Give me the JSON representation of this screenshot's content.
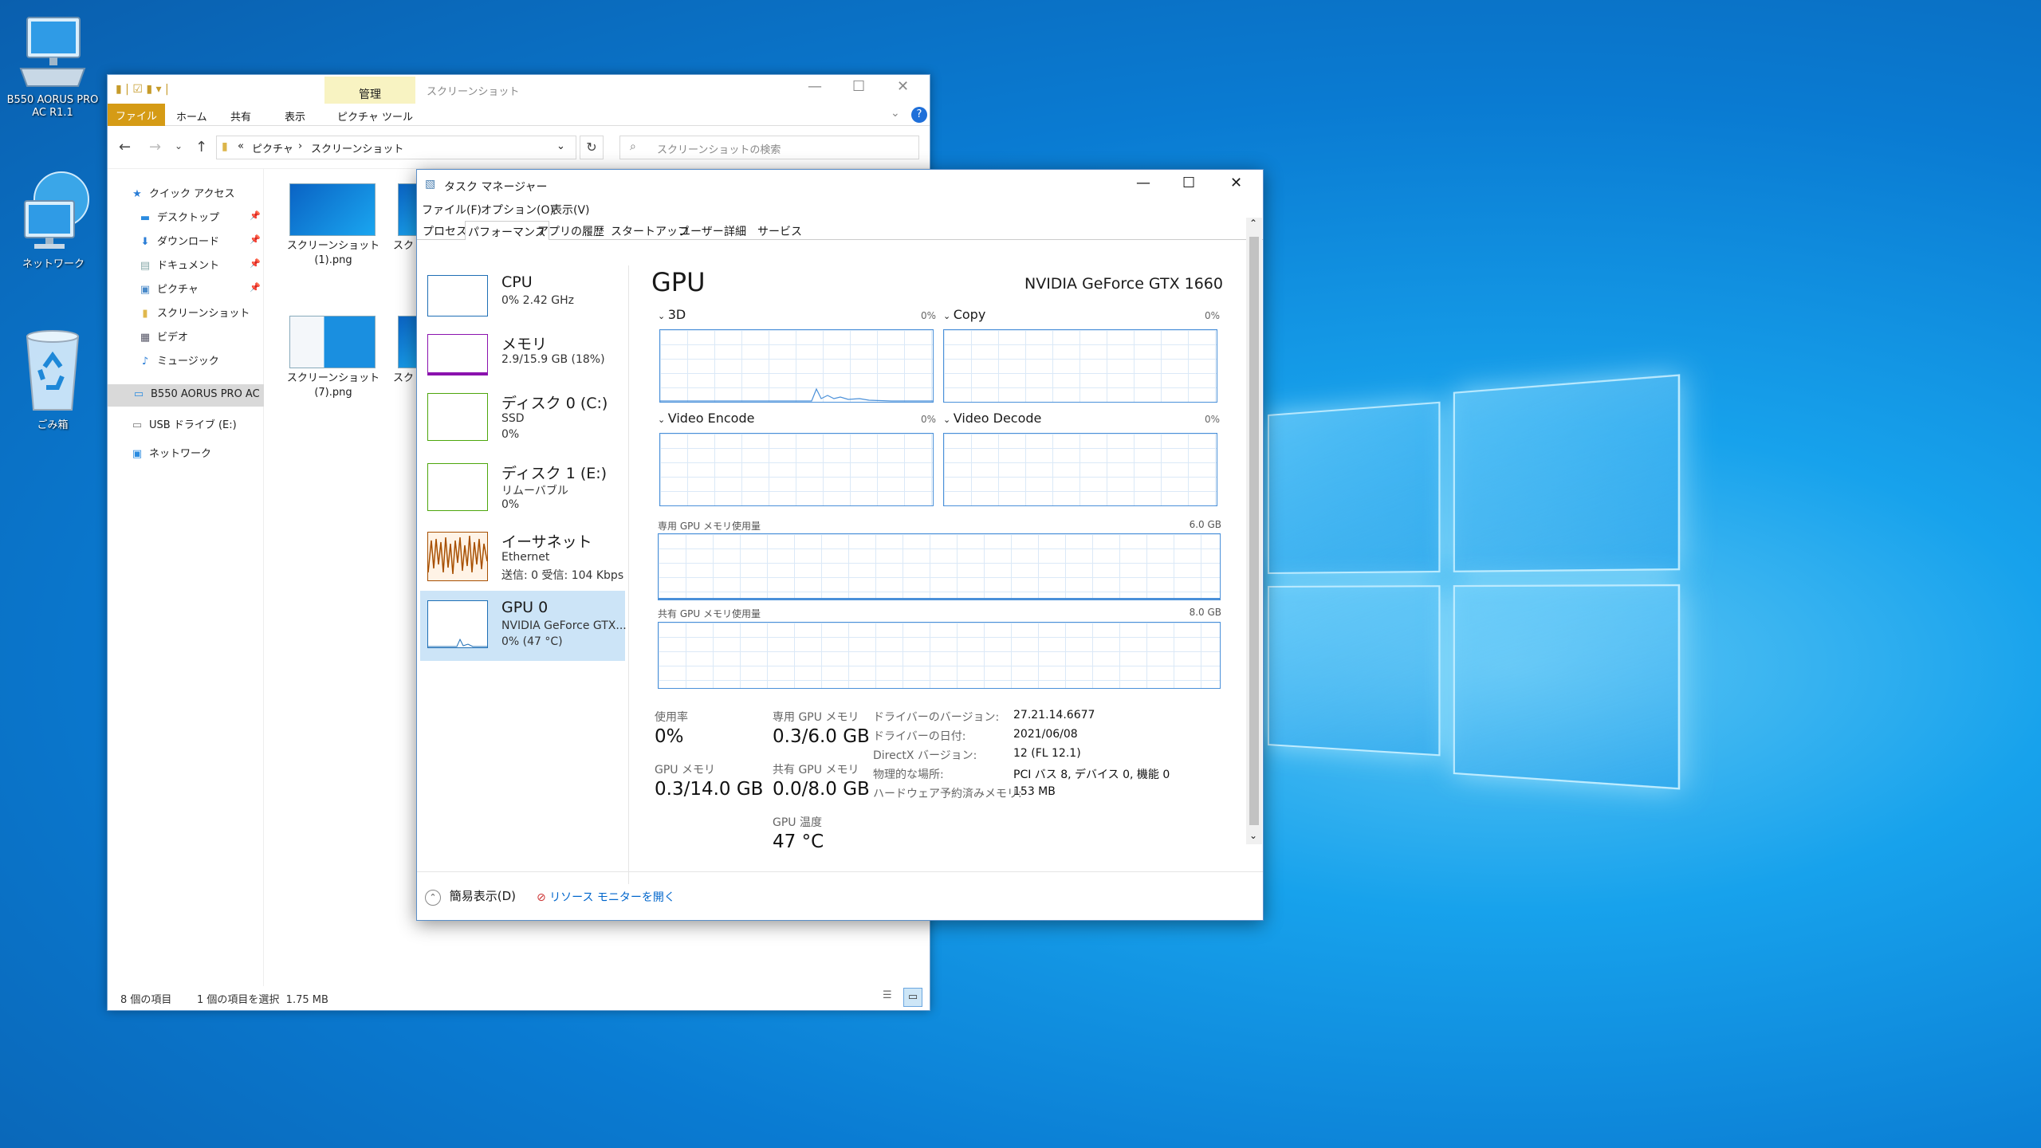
{
  "desktop": {
    "icons": [
      {
        "label": "B550 AORUS PRO\nAC R1.1",
        "icon": "computer-icon"
      },
      {
        "label": "ネットワーク",
        "icon": "network-icon"
      },
      {
        "label": "ごみ箱",
        "icon": "recycle-bin-icon"
      }
    ],
    "colors": {
      "background": "#0a7bd2",
      "logo": "#7fd3ff"
    }
  },
  "explorer": {
    "ribbon_context_group": "管理",
    "window_title": "スクリーンショット",
    "tabs": [
      "ファイル",
      "ホーム",
      "共有",
      "表示",
      "ピクチャ ツール"
    ],
    "address": {
      "prefix": "«",
      "parent": "ピクチャ",
      "current": "スクリーンショット"
    },
    "search_placeholder": "スクリーンショットの検索",
    "nav": [
      {
        "label": "クイック アクセス",
        "icon": "star-icon"
      },
      {
        "label": "デスクトップ",
        "icon": "desktop-icon",
        "pinned": true
      },
      {
        "label": "ダウンロード",
        "icon": "download-icon",
        "pinned": true
      },
      {
        "label": "ドキュメント",
        "icon": "document-icon",
        "pinned": true
      },
      {
        "label": "ピクチャ",
        "icon": "pictures-icon",
        "pinned": true
      },
      {
        "label": "スクリーンショット",
        "icon": "folder-icon"
      },
      {
        "label": "ビデオ",
        "icon": "video-icon"
      },
      {
        "label": "ミュージック",
        "icon": "music-icon"
      },
      {
        "label": "B550 AORUS PRO AC",
        "icon": "computer-icon"
      },
      {
        "label": "USB ドライブ (E:)",
        "icon": "usb-drive-icon"
      },
      {
        "label": "ネットワーク",
        "icon": "network-icon"
      }
    ],
    "files": [
      {
        "name": "スクリーンショット\n(1).png"
      },
      {
        "name": "スク"
      },
      {
        "name": "スクリーンショット\n(7).png"
      },
      {
        "name": "スク"
      }
    ],
    "status": {
      "count": "8 個の項目",
      "selection": "1 個の項目を選択  1.75 MB"
    }
  },
  "taskmanager": {
    "title": "タスク マネージャー",
    "menu": [
      "ファイル(F)",
      "オプション(O)",
      "表示(V)"
    ],
    "tabs": [
      "プロセス",
      "パフォーマンス",
      "アプリの履歴",
      "スタートアップ",
      "ユーザー",
      "詳細",
      "サービス"
    ],
    "selected_tab": "パフォーマンス",
    "sidebar": [
      {
        "name": "CPU",
        "l1": "0% 2.42 GHz",
        "l2": "",
        "color": "#1f6fb5"
      },
      {
        "name": "メモリ",
        "l1": "2.9/15.9 GB (18%)",
        "l2": "",
        "color": "#8b12ae"
      },
      {
        "name": "ディスク 0 (C:)",
        "l1": "SSD",
        "l2": "0%",
        "color": "#4da60c"
      },
      {
        "name": "ディスク 1 (E:)",
        "l1": "リムーバブル",
        "l2": "0%",
        "color": "#4da60c"
      },
      {
        "name": "イーサネット",
        "l1": "Ethernet",
        "l2": "送信: 0 受信: 104 Kbps",
        "color": "#a74f01"
      },
      {
        "name": "GPU 0",
        "l1": "NVIDIA GeForce GTX...",
        "l2": "0% (47 °C)",
        "color": "#1f6fb5",
        "selected": true
      }
    ],
    "gpu": {
      "heading": "GPU",
      "model": "NVIDIA GeForce GTX 1660",
      "engines": [
        {
          "label": "3D",
          "pct": "0%"
        },
        {
          "label": "Copy",
          "pct": "0%"
        },
        {
          "label": "Video Encode",
          "pct": "0%"
        },
        {
          "label": "Video Decode",
          "pct": "0%"
        }
      ],
      "dedicated_label": "専用 GPU メモリ使用量",
      "dedicated_max": "6.0 GB",
      "shared_label": "共有 GPU メモリ使用量",
      "shared_max": "8.0 GB",
      "stats": {
        "util_label": "使用率",
        "util": "0%",
        "ded_label": "専用 GPU メモリ",
        "ded": "0.3/6.0 GB",
        "gpumem_label": "GPU メモリ",
        "gpumem": "0.3/14.0 GB",
        "shr_label": "共有 GPU メモリ",
        "shr": "0.0/8.0 GB",
        "temp_label": "GPU 温度",
        "temp": "47 °C"
      },
      "details": [
        {
          "k": "ドライバーのバージョン:",
          "v": "27.21.14.6677"
        },
        {
          "k": "ドライバーの日付:",
          "v": "2021/06/08"
        },
        {
          "k": "DirectX バージョン:",
          "v": "12 (FL 12.1)"
        },
        {
          "k": "物理的な場所:",
          "v": "PCI バス 8, デバイス 0, 機能 0"
        },
        {
          "k": "ハードウェア予約済みメモリ:",
          "v": "153 MB"
        }
      ]
    },
    "footer": {
      "fewer": "簡易表示(D)",
      "monitor": "リソース モニターを開く"
    }
  }
}
